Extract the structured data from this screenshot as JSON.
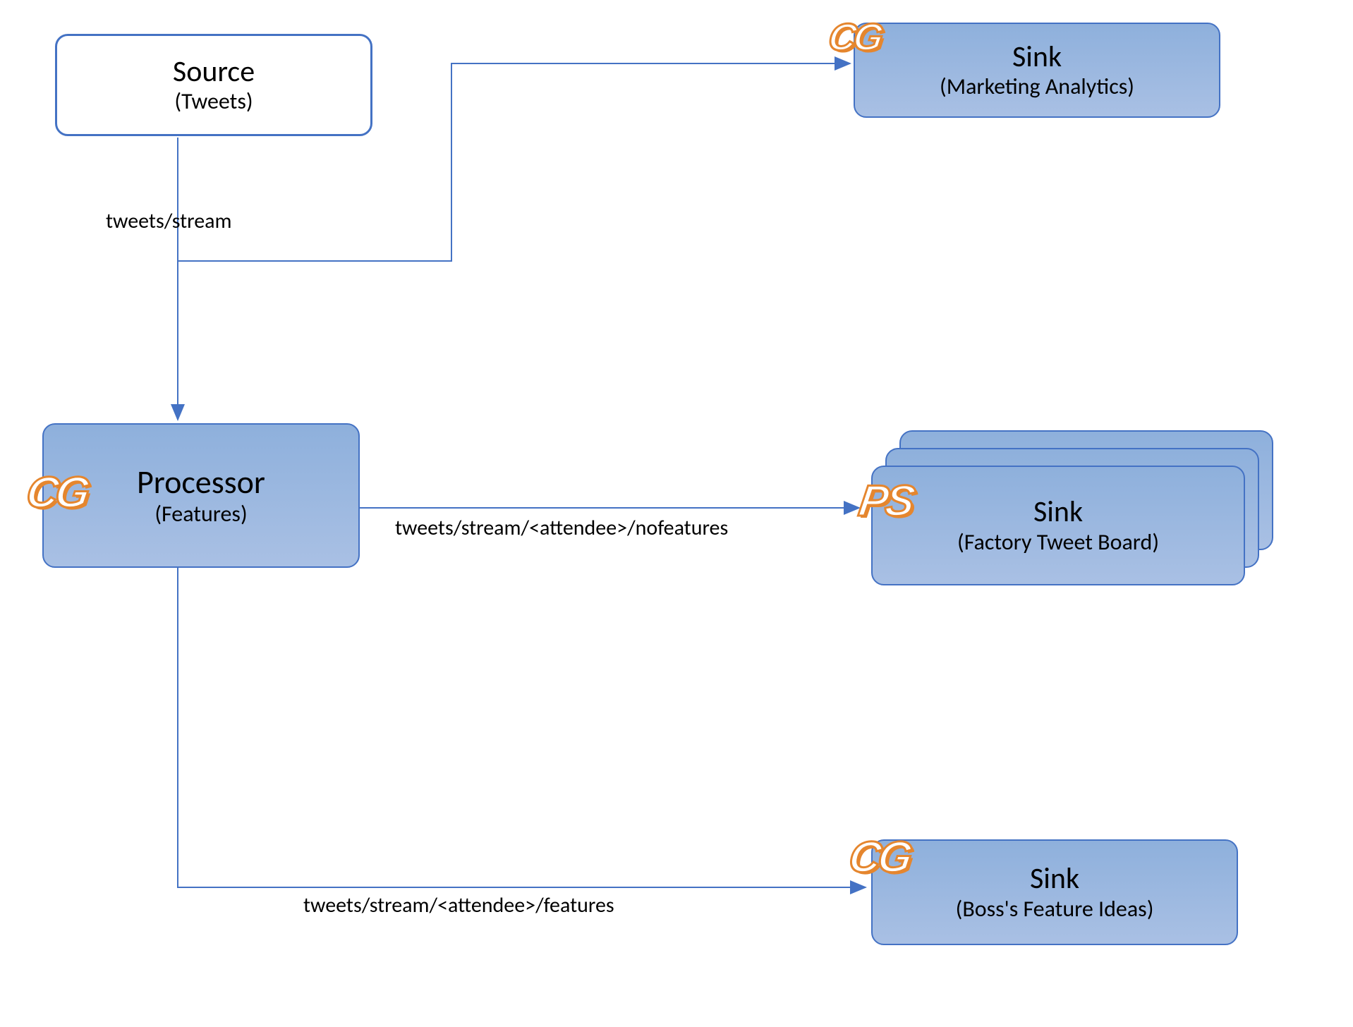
{
  "nodes": {
    "source": {
      "title": "Source",
      "sub": "(Tweets)"
    },
    "sink_marketing": {
      "title": "Sink",
      "sub": "(Marketing Analytics)"
    },
    "processor": {
      "title": "Processor",
      "sub": "(Features)"
    },
    "sink_factory": {
      "title": "Sink",
      "sub": "(Factory Tweet Board)"
    },
    "sink_boss": {
      "title": "Sink",
      "sub": "(Boss's Feature Ideas)"
    }
  },
  "edges": {
    "source_to_processor": "tweets/stream",
    "processor_to_factory": "tweets/stream/<attendee>/nofeatures",
    "processor_to_boss": "tweets/stream/<attendee>/features"
  },
  "badges": {
    "cg": "CG",
    "ps": "PS"
  }
}
